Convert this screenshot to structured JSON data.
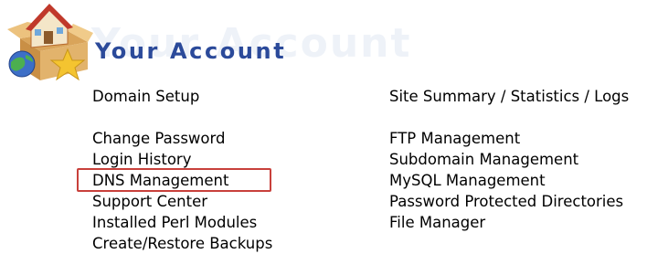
{
  "header": {
    "title": "Your Account",
    "logo_icon": "house-box-globe-star-icon",
    "title_color": "#2b4a9a"
  },
  "left_menu": [
    {
      "label": "Domain Setup"
    },
    {
      "label": "Change Password"
    },
    {
      "label": "Login History"
    },
    {
      "label": "DNS Management"
    },
    {
      "label": "Support Center"
    },
    {
      "label": "Installed Perl Modules"
    },
    {
      "label": "Create/Restore Backups"
    }
  ],
  "right_menu": [
    {
      "label": "Site Summary / Statistics / Logs"
    },
    {
      "label": "FTP Management"
    },
    {
      "label": "Subdomain Management"
    },
    {
      "label": "MySQL Management"
    },
    {
      "label": "Password Protected Directories"
    },
    {
      "label": "File Manager"
    }
  ],
  "highlight": {
    "target": "DNS Management",
    "color": "#c8403b"
  }
}
